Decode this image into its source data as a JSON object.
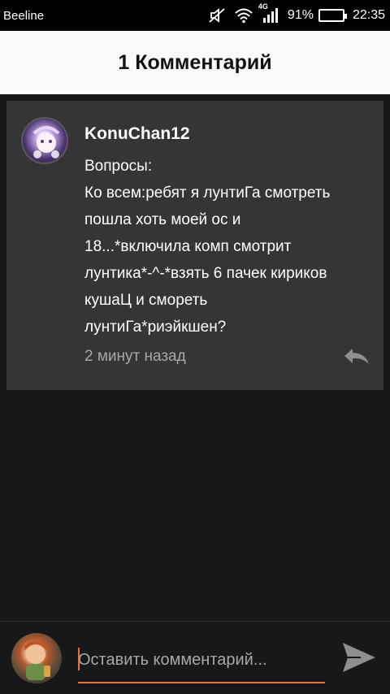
{
  "status_bar": {
    "carrier": "Beeline",
    "network": "4G",
    "battery": "91%",
    "battery_level": 0.91,
    "time": "22:35",
    "icons": [
      "mute-icon",
      "wifi-icon",
      "signal-icon",
      "battery-icon"
    ]
  },
  "header": {
    "title": "1 Комментарий"
  },
  "comment": {
    "author": "KonuChan12",
    "lines": [
      "Вопросы:",
      "Ко всем:ребят я лунтиГа смотреть",
      "пошла хоть моей ос и",
      "18...*включила комп смотрит",
      "лунтика*-^-*взять 6 пачек кириков",
      "кушаЦ и смореть",
      "лунтиГа*риэйкшен?"
    ],
    "time": "2 минут назад",
    "reply_icon": "reply-icon"
  },
  "input": {
    "placeholder": "Оставить комментарий...",
    "value": "",
    "send_icon": "send-icon"
  },
  "colors": {
    "accent": "#f26b3a",
    "card_bg": "#353537",
    "page_bg": "#18171a",
    "header_bg": "#fafafa"
  }
}
